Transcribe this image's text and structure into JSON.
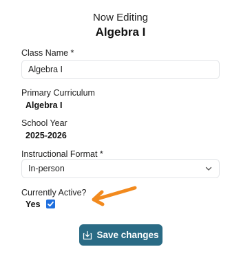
{
  "header": {
    "subtitle": "Now Editing",
    "title": "Algebra I"
  },
  "form": {
    "class_name": {
      "label": "Class Name *",
      "value": "Algebra I"
    },
    "primary_curriculum": {
      "label": "Primary Curriculum",
      "value": "Algebra I"
    },
    "school_year": {
      "label": "School Year",
      "value": "2025-2026"
    },
    "instructional_format": {
      "label": "Instructional Format *",
      "selected": "In-person"
    },
    "currently_active": {
      "label": "Currently Active?",
      "option_label": "Yes",
      "checked": true
    }
  },
  "actions": {
    "save_label": "Save changes"
  },
  "colors": {
    "button_bg": "#2a6b85",
    "checkbox_accent": "#1f6fde",
    "annotation_arrow": "#f28a1e"
  },
  "icons": {
    "save": "download-tray-icon",
    "select": "chevron-down-icon",
    "annotation": "annotation-arrow-icon"
  }
}
